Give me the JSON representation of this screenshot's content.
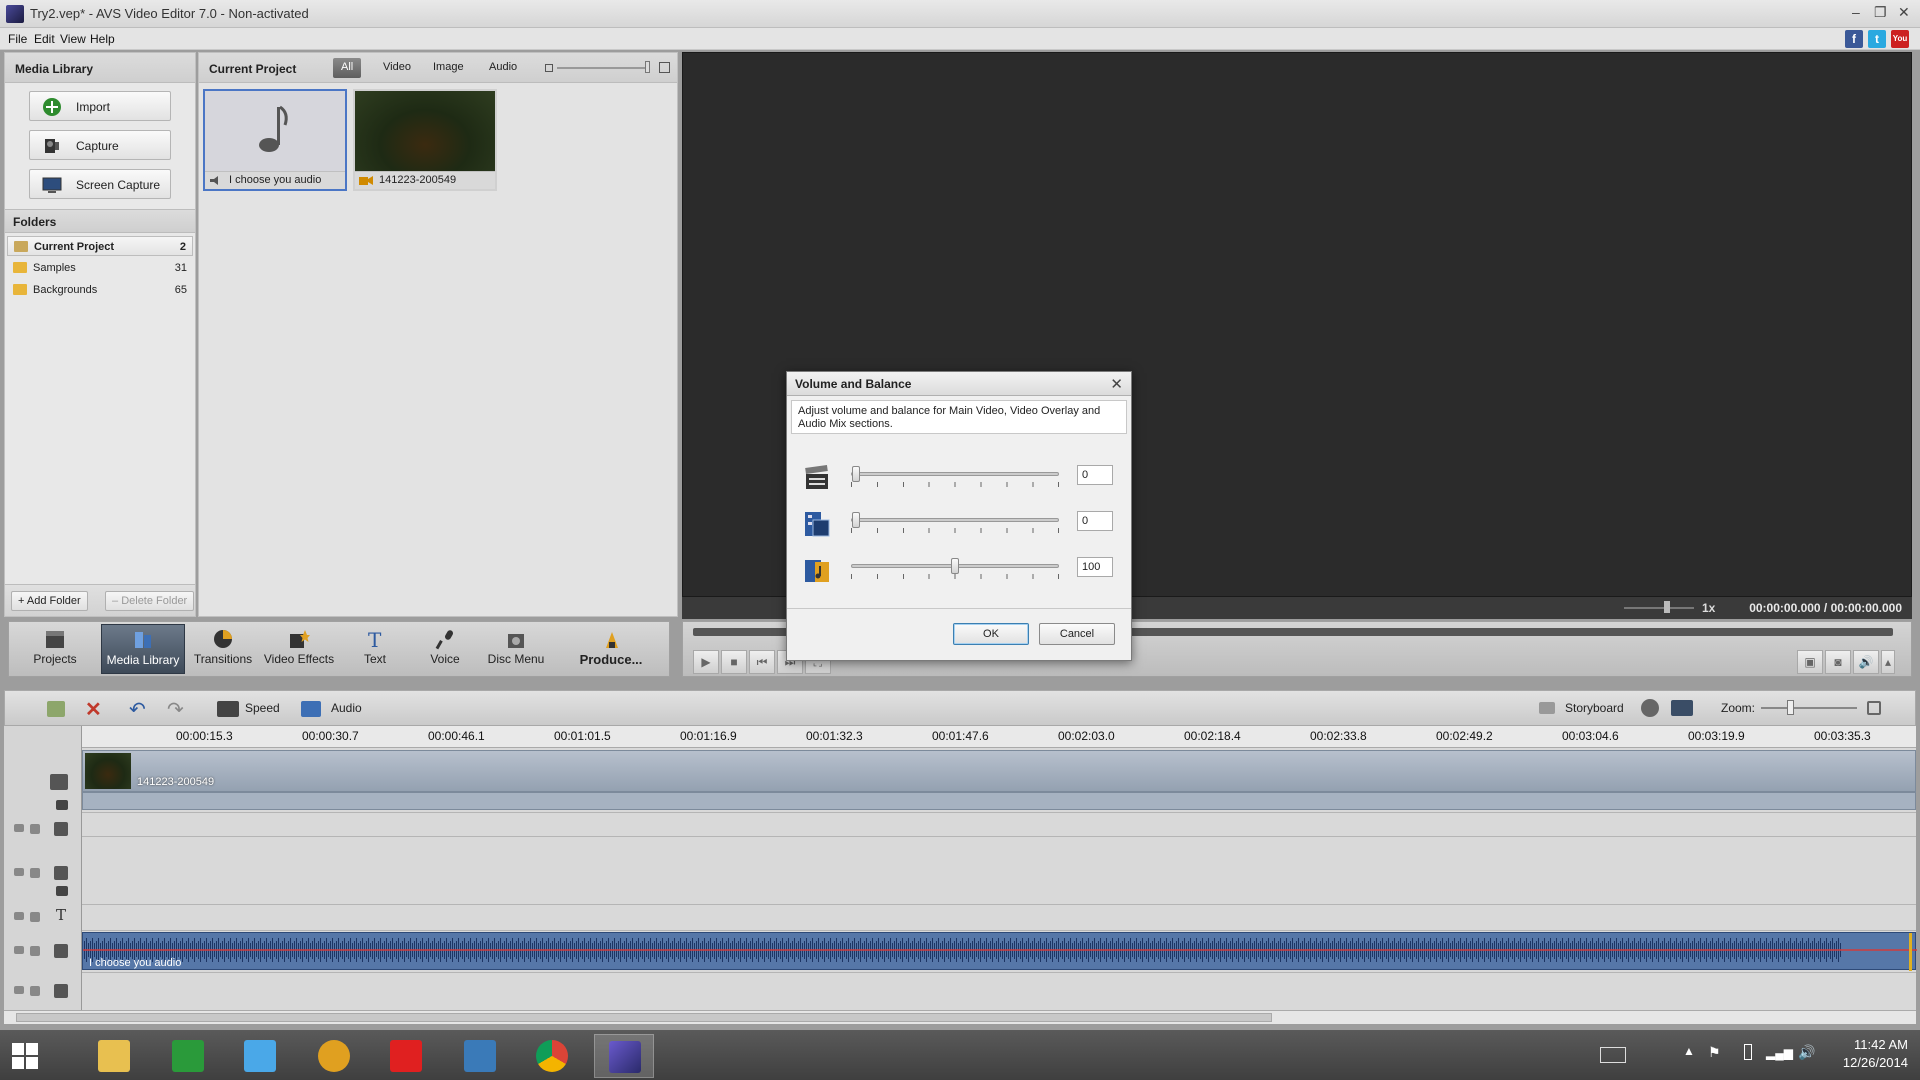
{
  "window": {
    "title": "Try2.vep* - AVS Video Editor 7.0 - Non-activated",
    "controls": [
      "–",
      "❐",
      "✕"
    ]
  },
  "menu": [
    "File",
    "Edit",
    "View",
    "Help"
  ],
  "social": [
    "f",
    "t",
    "You"
  ],
  "media_library": {
    "header": "Media Library",
    "buttons": [
      "Import",
      "Capture",
      "Screen Capture"
    ],
    "folders_header": "Folders",
    "folders": [
      {
        "name": "Current Project",
        "count": "2"
      },
      {
        "name": "Samples",
        "count": "31"
      },
      {
        "name": "Backgrounds",
        "count": "65"
      }
    ],
    "add_folder": "Add Folder",
    "delete_folder": "Delete Folder"
  },
  "current_project": {
    "header": "Current Project",
    "filters": [
      "All",
      "Video",
      "Image",
      "Audio"
    ],
    "items": [
      {
        "label": "I choose you audio",
        "type": "audio"
      },
      {
        "label": "141223-200549",
        "type": "video"
      }
    ]
  },
  "preview": {
    "speed": "1x",
    "timecode": "00:00:00.000 / 00:00:00.000"
  },
  "toolbar": {
    "buttons": [
      "Projects",
      "Media Library",
      "Transitions",
      "Video Effects",
      "Text",
      "Voice",
      "Disc Menu",
      "Produce..."
    ]
  },
  "timeline": {
    "speed_label": "Speed",
    "audio_label": "Audio",
    "storyboard_label": "Storyboard",
    "zoom_label": "Zoom:",
    "ruler": [
      "00:00:15.3",
      "00:00:30.7",
      "00:00:46.1",
      "00:01:01.5",
      "00:01:16.9",
      "00:01:32.3",
      "00:01:47.6",
      "00:02:03.0",
      "00:02:18.4",
      "00:02:33.8",
      "00:02:49.2",
      "00:03:04.6",
      "00:03:19.9",
      "00:03:35.3"
    ],
    "video_clip": "141223-200549",
    "audio_clip": "I choose you audio"
  },
  "dialog": {
    "title": "Volume and Balance",
    "description": "Adjust volume and balance for Main Video, Video Overlay and Audio Mix sections.",
    "rows": [
      {
        "icon": "main-video-icon",
        "value": "0"
      },
      {
        "icon": "video-overlay-icon",
        "value": "0"
      },
      {
        "icon": "audio-mix-icon",
        "value": "100"
      }
    ],
    "ok": "OK",
    "cancel": "Cancel"
  },
  "taskbar": {
    "time": "11:42 AM",
    "date": "12/26/2014"
  }
}
